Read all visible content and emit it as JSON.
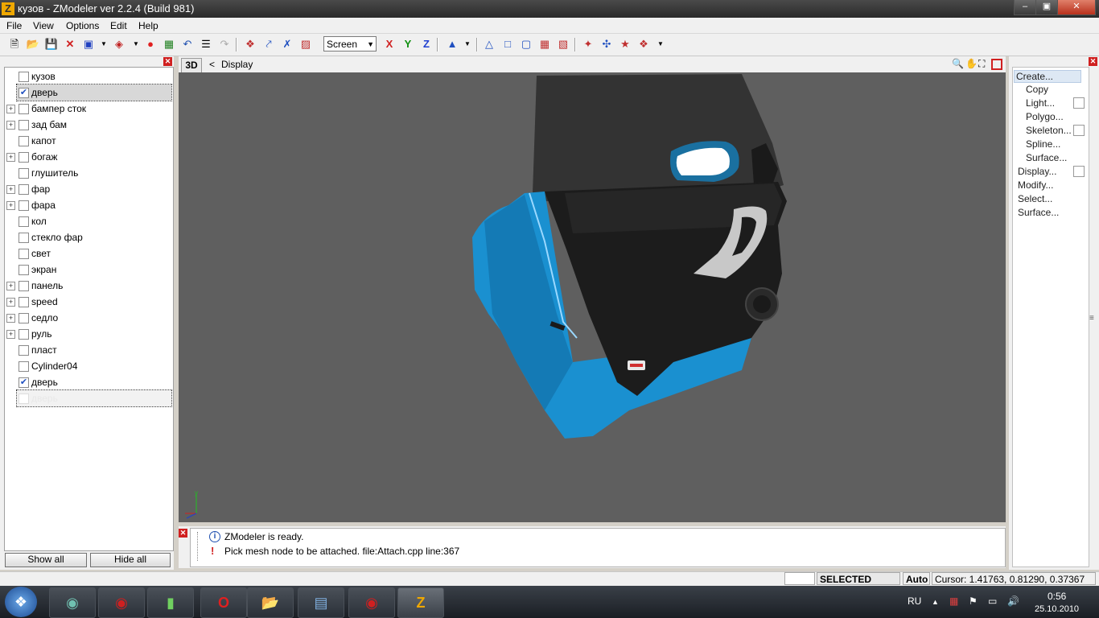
{
  "window": {
    "title": "кузов - ZModeler ver 2.2.4 (Build 981)",
    "app_icon": "Z"
  },
  "menubar": [
    "File",
    "View",
    "Options",
    "Edit",
    "Help"
  ],
  "toolbar": {
    "view_select": "Screen",
    "axis_x": "X",
    "axis_y": "Y",
    "axis_z": "Z"
  },
  "object_list": [
    {
      "label": "кузов",
      "expand": false,
      "checked": false
    },
    {
      "label": "дверь",
      "expand": false,
      "checked": true,
      "selected": true
    },
    {
      "label": "бампер сток",
      "expand": true,
      "checked": false
    },
    {
      "label": "зад бам",
      "expand": true,
      "checked": false
    },
    {
      "label": "капот",
      "expand": false,
      "checked": false
    },
    {
      "label": "богаж",
      "expand": true,
      "checked": false
    },
    {
      "label": "глушитель",
      "expand": false,
      "checked": false
    },
    {
      "label": "фар",
      "expand": true,
      "checked": false
    },
    {
      "label": "фара",
      "expand": true,
      "checked": false
    },
    {
      "label": "кол",
      "expand": false,
      "checked": false
    },
    {
      "label": "стекло фар",
      "expand": false,
      "checked": false
    },
    {
      "label": "свет",
      "expand": false,
      "checked": false
    },
    {
      "label": "экран",
      "expand": false,
      "checked": false
    },
    {
      "label": "панель",
      "expand": true,
      "checked": false
    },
    {
      "label": "speed",
      "expand": true,
      "checked": false
    },
    {
      "label": "седло",
      "expand": true,
      "checked": false
    },
    {
      "label": "руль",
      "expand": true,
      "checked": false
    },
    {
      "label": "пласт",
      "expand": false,
      "checked": false
    },
    {
      "label": "Cylinder04",
      "expand": false,
      "checked": false
    },
    {
      "label": "дверь",
      "expand": false,
      "checked": true
    },
    {
      "label": "дверь",
      "expand": false,
      "checked": false,
      "ghost": true
    }
  ],
  "left_buttons": {
    "show_all": "Show all",
    "hide_all": "Hide all"
  },
  "viewport": {
    "tab": "3D",
    "breadcrumb_arrow": "<",
    "breadcrumb": "Display"
  },
  "log": [
    {
      "icon": "info-icon",
      "text": "ZModeler is ready."
    },
    {
      "icon": "warning-icon",
      "text": "Pick mesh node to be attached. file:Attach.cpp line:367"
    }
  ],
  "command_panel": {
    "items": [
      {
        "label": "Create...",
        "level": 0,
        "highlight": true
      },
      {
        "label": "Copy",
        "level": 1,
        "checkbox": true
      },
      {
        "label": "Light...",
        "level": 1
      },
      {
        "label": "Polygo...",
        "level": 1,
        "checkbox": true
      },
      {
        "label": "Skeleton...",
        "level": 1
      },
      {
        "label": "Spline...",
        "level": 1
      },
      {
        "label": "Surface...",
        "level": 1,
        "checkbox": true
      },
      {
        "label": "Display...",
        "level": 0
      },
      {
        "label": "Modify...",
        "level": 0
      },
      {
        "label": "Select...",
        "level": 0
      },
      {
        "label": "Surface...",
        "level": 0
      }
    ]
  },
  "statusbar": {
    "mode": "SELECTED MODE",
    "auto": "Auto",
    "cursor": "Cursor: 1.41763, 0.81290, 0.37367"
  },
  "taskbar": {
    "lang": "RU",
    "time": "0:56",
    "date": "25.10.2010"
  },
  "colors": {
    "door_blue": "#1a90d0",
    "viewport_bg": "#5f5f5f",
    "trim_black": "#1c1c1c"
  }
}
